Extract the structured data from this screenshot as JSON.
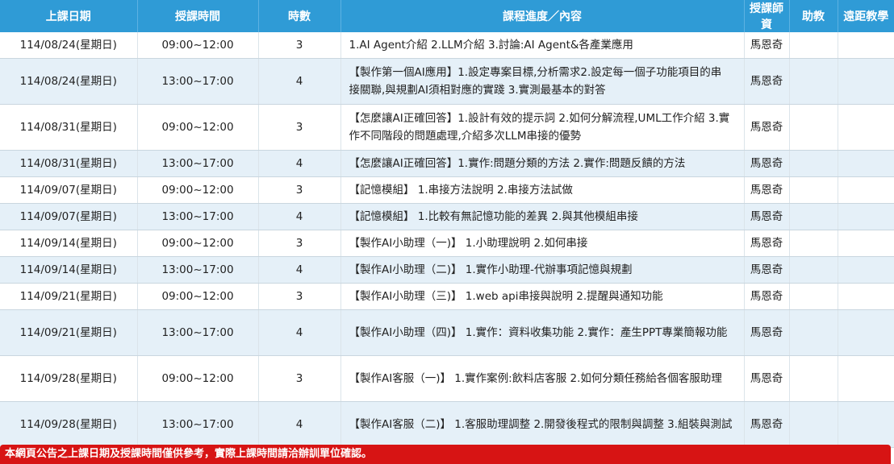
{
  "headers": {
    "date": "上課日期",
    "time": "授課時間",
    "hours": "時數",
    "content": "課程進度／內容",
    "teacher": "授課師資",
    "assistant": "助教",
    "remote": "遠距教學"
  },
  "rows": [
    {
      "date": "114/08/24(星期日)",
      "time": "09:00~12:00",
      "hours": "3",
      "content": "1.AI Agent介紹 2.LLM介紹 3.討論:AI Agent&各產業應用",
      "teacher": "馬恩奇",
      "assistant": "",
      "remote": ""
    },
    {
      "date": "114/08/24(星期日)",
      "time": "13:00~17:00",
      "hours": "4",
      "content": "【製作第一個AI應用】1.設定專案目標,分析需求2.設定每一個子功能項目的串接關聯,與規劃AI須相對應的實踐 3.實測最基本的對答",
      "teacher": "馬恩奇",
      "assistant": "",
      "remote": ""
    },
    {
      "date": "114/08/31(星期日)",
      "time": "09:00~12:00",
      "hours": "3",
      "content": "【怎麼讓AI正確回答】1.設計有效的提示詞 2.如何分解流程,UML工作介紹 3.實作不同階段的問題處理,介紹多次LLM串接的優勢",
      "teacher": "馬恩奇",
      "assistant": "",
      "remote": ""
    },
    {
      "date": "114/08/31(星期日)",
      "time": "13:00~17:00",
      "hours": "4",
      "content": "【怎麼讓AI正確回答】1.實作:問題分類的方法 2.實作:問題反饋的方法",
      "teacher": "馬恩奇",
      "assistant": "",
      "remote": ""
    },
    {
      "date": "114/09/07(星期日)",
      "time": "09:00~12:00",
      "hours": "3",
      "content": "【記憶模組】 1.串接方法說明 2.串接方法試做",
      "teacher": "馬恩奇",
      "assistant": "",
      "remote": ""
    },
    {
      "date": "114/09/07(星期日)",
      "time": "13:00~17:00",
      "hours": "4",
      "content": "【記憶模組】 1.比較有無記憶功能的差異 2.與其他模組串接",
      "teacher": "馬恩奇",
      "assistant": "",
      "remote": ""
    },
    {
      "date": "114/09/14(星期日)",
      "time": "09:00~12:00",
      "hours": "3",
      "content": "【製作AI小助理（一)】 1.小助理說明 2.如何串接",
      "teacher": "馬恩奇",
      "assistant": "",
      "remote": ""
    },
    {
      "date": "114/09/14(星期日)",
      "time": "13:00~17:00",
      "hours": "4",
      "content": "【製作AI小助理（二)】 1.實作小助理-代辦事項記憶與規劃",
      "teacher": "馬恩奇",
      "assistant": "",
      "remote": ""
    },
    {
      "date": "114/09/21(星期日)",
      "time": "09:00~12:00",
      "hours": "3",
      "content": "【製作AI小助理（三)】 1.web api串接與說明 2.提醒與通知功能",
      "teacher": "馬恩奇",
      "assistant": "",
      "remote": ""
    },
    {
      "date": "114/09/21(星期日)",
      "time": "13:00~17:00",
      "hours": "4",
      "content": "【製作AI小助理（四)】 1.實作：資料收集功能 2.實作：產生PPT專業簡報功能",
      "teacher": "馬恩奇",
      "assistant": "",
      "remote": ""
    },
    {
      "date": "114/09/28(星期日)",
      "time": "09:00~12:00",
      "hours": "3",
      "content": "【製作AI客服（一)】 1.實作案例:飲料店客服 2.如何分類任務給各個客服助理",
      "teacher": "馬恩奇",
      "assistant": "",
      "remote": ""
    },
    {
      "date": "114/09/28(星期日)",
      "time": "13:00~17:00",
      "hours": "4",
      "content": "【製作AI客服（二)】 1.客服助理調整 2.開發後程式的限制與調整 3.組裝與測試",
      "teacher": "馬恩奇",
      "assistant": "",
      "remote": ""
    }
  ],
  "notice": "本網頁公告之上課日期及授課時間僅供參考，實際上課時間請洽辦訓單位確認。"
}
